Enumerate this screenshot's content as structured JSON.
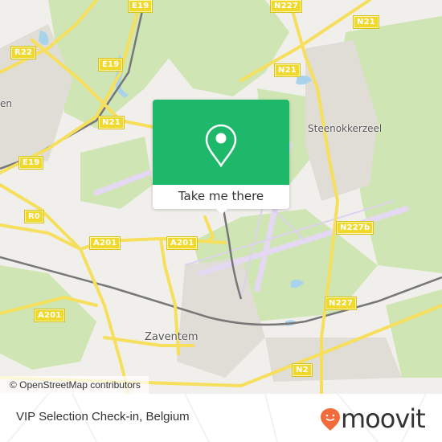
{
  "map": {
    "place_labels": [
      {
        "id": "steenokkerzeel",
        "text": "Steenokkerzeel"
      },
      {
        "id": "zaventem",
        "text": "Zaventem"
      },
      {
        "id": "partial-west",
        "text": "en"
      }
    ],
    "road_shields": [
      {
        "id": "e19-top",
        "text": "E19"
      },
      {
        "id": "n227-top",
        "text": "N227"
      },
      {
        "id": "n21-top-right",
        "text": "N21"
      },
      {
        "id": "r22",
        "text": "R22"
      },
      {
        "id": "e19-mid",
        "text": "E19"
      },
      {
        "id": "n21-mid",
        "text": "N21"
      },
      {
        "id": "n21-left",
        "text": "N21"
      },
      {
        "id": "e19-left",
        "text": "E19"
      },
      {
        "id": "r0",
        "text": "R0"
      },
      {
        "id": "a201-a",
        "text": "A201"
      },
      {
        "id": "a201-b",
        "text": "A201"
      },
      {
        "id": "n227b",
        "text": "N227b"
      },
      {
        "id": "a201-c",
        "text": "A201"
      },
      {
        "id": "n227-bottom",
        "text": "N227"
      },
      {
        "id": "n2",
        "text": "N2"
      }
    ],
    "attribution": "© OpenStreetMap contributors"
  },
  "popup": {
    "icon": "location-pin-icon",
    "button_label": "Take me there",
    "accent_color": "#1eb86a"
  },
  "footer": {
    "title": "VIP Selection Check-in, Belgium",
    "brand": "moovit",
    "brand_color": "#f26b3a"
  }
}
